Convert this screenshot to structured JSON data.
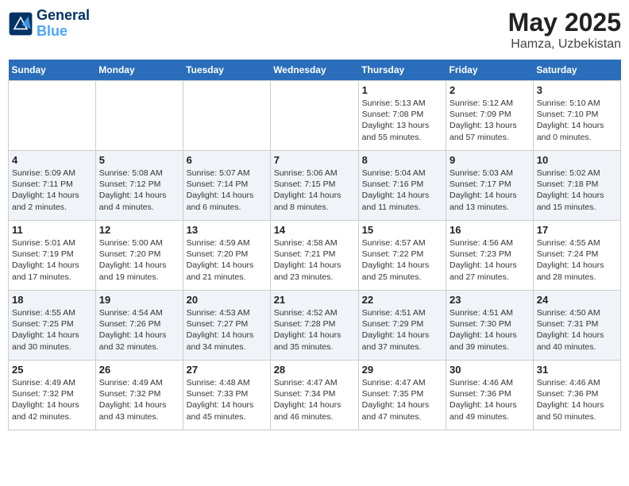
{
  "header": {
    "logo_line1": "General",
    "logo_line2": "Blue",
    "title": "May 2025",
    "subtitle": "Hamza, Uzbekistan"
  },
  "days_of_week": [
    "Sunday",
    "Monday",
    "Tuesday",
    "Wednesday",
    "Thursday",
    "Friday",
    "Saturday"
  ],
  "weeks": [
    [
      {
        "day": null,
        "content": null
      },
      {
        "day": null,
        "content": null
      },
      {
        "day": null,
        "content": null
      },
      {
        "day": null,
        "content": null
      },
      {
        "day": "1",
        "content": "Sunrise: 5:13 AM\nSunset: 7:08 PM\nDaylight: 13 hours and 55 minutes."
      },
      {
        "day": "2",
        "content": "Sunrise: 5:12 AM\nSunset: 7:09 PM\nDaylight: 13 hours and 57 minutes."
      },
      {
        "day": "3",
        "content": "Sunrise: 5:10 AM\nSunset: 7:10 PM\nDaylight: 14 hours and 0 minutes."
      }
    ],
    [
      {
        "day": "4",
        "content": "Sunrise: 5:09 AM\nSunset: 7:11 PM\nDaylight: 14 hours and 2 minutes."
      },
      {
        "day": "5",
        "content": "Sunrise: 5:08 AM\nSunset: 7:12 PM\nDaylight: 14 hours and 4 minutes."
      },
      {
        "day": "6",
        "content": "Sunrise: 5:07 AM\nSunset: 7:14 PM\nDaylight: 14 hours and 6 minutes."
      },
      {
        "day": "7",
        "content": "Sunrise: 5:06 AM\nSunset: 7:15 PM\nDaylight: 14 hours and 8 minutes."
      },
      {
        "day": "8",
        "content": "Sunrise: 5:04 AM\nSunset: 7:16 PM\nDaylight: 14 hours and 11 minutes."
      },
      {
        "day": "9",
        "content": "Sunrise: 5:03 AM\nSunset: 7:17 PM\nDaylight: 14 hours and 13 minutes."
      },
      {
        "day": "10",
        "content": "Sunrise: 5:02 AM\nSunset: 7:18 PM\nDaylight: 14 hours and 15 minutes."
      }
    ],
    [
      {
        "day": "11",
        "content": "Sunrise: 5:01 AM\nSunset: 7:19 PM\nDaylight: 14 hours and 17 minutes."
      },
      {
        "day": "12",
        "content": "Sunrise: 5:00 AM\nSunset: 7:20 PM\nDaylight: 14 hours and 19 minutes."
      },
      {
        "day": "13",
        "content": "Sunrise: 4:59 AM\nSunset: 7:20 PM\nDaylight: 14 hours and 21 minutes."
      },
      {
        "day": "14",
        "content": "Sunrise: 4:58 AM\nSunset: 7:21 PM\nDaylight: 14 hours and 23 minutes."
      },
      {
        "day": "15",
        "content": "Sunrise: 4:57 AM\nSunset: 7:22 PM\nDaylight: 14 hours and 25 minutes."
      },
      {
        "day": "16",
        "content": "Sunrise: 4:56 AM\nSunset: 7:23 PM\nDaylight: 14 hours and 27 minutes."
      },
      {
        "day": "17",
        "content": "Sunrise: 4:55 AM\nSunset: 7:24 PM\nDaylight: 14 hours and 28 minutes."
      }
    ],
    [
      {
        "day": "18",
        "content": "Sunrise: 4:55 AM\nSunset: 7:25 PM\nDaylight: 14 hours and 30 minutes."
      },
      {
        "day": "19",
        "content": "Sunrise: 4:54 AM\nSunset: 7:26 PM\nDaylight: 14 hours and 32 minutes."
      },
      {
        "day": "20",
        "content": "Sunrise: 4:53 AM\nSunset: 7:27 PM\nDaylight: 14 hours and 34 minutes."
      },
      {
        "day": "21",
        "content": "Sunrise: 4:52 AM\nSunset: 7:28 PM\nDaylight: 14 hours and 35 minutes."
      },
      {
        "day": "22",
        "content": "Sunrise: 4:51 AM\nSunset: 7:29 PM\nDaylight: 14 hours and 37 minutes."
      },
      {
        "day": "23",
        "content": "Sunrise: 4:51 AM\nSunset: 7:30 PM\nDaylight: 14 hours and 39 minutes."
      },
      {
        "day": "24",
        "content": "Sunrise: 4:50 AM\nSunset: 7:31 PM\nDaylight: 14 hours and 40 minutes."
      }
    ],
    [
      {
        "day": "25",
        "content": "Sunrise: 4:49 AM\nSunset: 7:32 PM\nDaylight: 14 hours and 42 minutes."
      },
      {
        "day": "26",
        "content": "Sunrise: 4:49 AM\nSunset: 7:32 PM\nDaylight: 14 hours and 43 minutes."
      },
      {
        "day": "27",
        "content": "Sunrise: 4:48 AM\nSunset: 7:33 PM\nDaylight: 14 hours and 45 minutes."
      },
      {
        "day": "28",
        "content": "Sunrise: 4:47 AM\nSunset: 7:34 PM\nDaylight: 14 hours and 46 minutes."
      },
      {
        "day": "29",
        "content": "Sunrise: 4:47 AM\nSunset: 7:35 PM\nDaylight: 14 hours and 47 minutes."
      },
      {
        "day": "30",
        "content": "Sunrise: 4:46 AM\nSunset: 7:36 PM\nDaylight: 14 hours and 49 minutes."
      },
      {
        "day": "31",
        "content": "Sunrise: 4:46 AM\nSunset: 7:36 PM\nDaylight: 14 hours and 50 minutes."
      }
    ]
  ]
}
